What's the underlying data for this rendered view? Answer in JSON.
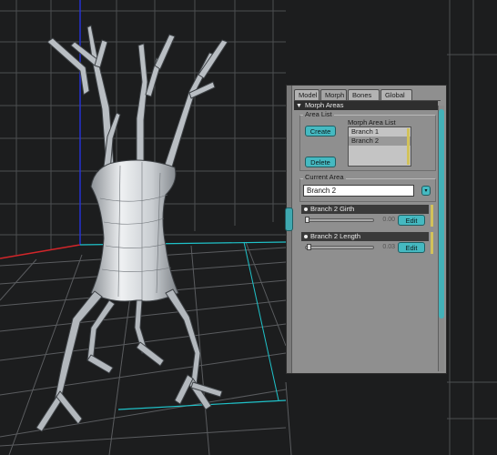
{
  "tabs": [
    {
      "label": "Model",
      "active": false
    },
    {
      "label": "Morph",
      "active": true
    },
    {
      "label": "Bones",
      "active": false
    },
    {
      "label": "Global",
      "active": false
    }
  ],
  "section": {
    "title": "Morph Areas",
    "caret": "▼"
  },
  "area_list": {
    "title": "Area List",
    "create_label": "Create",
    "delete_label": "Delete",
    "list_title": "Morph Area List",
    "items": [
      "Branch 1",
      "Branch 2"
    ],
    "selected": "Branch 2"
  },
  "current_area": {
    "title": "Current Area",
    "value": "Branch 2",
    "dropdown_icon": "▾"
  },
  "dials": [
    {
      "name": "Branch 2 Girth",
      "value": "0.00",
      "edit_label": "Edit",
      "level": 0.0
    },
    {
      "name": "Branch 2 Length",
      "value": "0.03",
      "edit_label": "Edit",
      "level": 0.03
    }
  ],
  "colors": {
    "accent": "#45b9c1",
    "panel": "#8f8f8f",
    "viewport_bg": "#1c1d1e",
    "grid_x_axis": "#d2262a",
    "grid_y_axis": "#2532d2",
    "grid_z_axis": "#1fc2c9"
  }
}
